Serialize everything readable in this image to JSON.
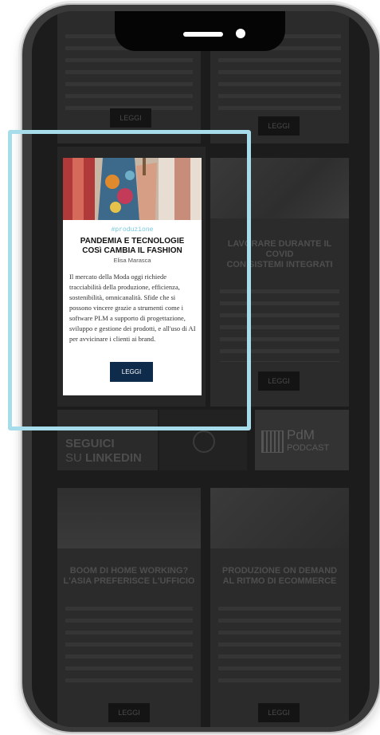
{
  "highlight_card": {
    "tag": "#produzione",
    "title_line1": "PANDEMIA E TECNOLOGIE",
    "title_line2": "COSì CAMBIA IL FASHION",
    "author": "Elisa Marasca",
    "body": "Il mercato della Moda oggi richiede tracciabilità della produzione, efficienza, sostenibilità, omnicanalità. Sfide che si possono vincere grazie a strumenti come i software PLM a supporto di progettazione, sviluppo e gestione dei prodotti, e all'uso di AI per avvicinare i clienti ai brand.",
    "button_label": "LEGGI"
  },
  "background": {
    "top_left_button": "LEGGI",
    "top_right_button": "LEGGI",
    "mid_right": {
      "title_line1": "LAVORARE DURANTE IL",
      "title_line2": "COVID",
      "title_line3": "CON SISTEMI INTEGRATI",
      "button_label": "LEGGI"
    },
    "banner_linkedin": {
      "line1": "SEGUICI",
      "line2": "SU",
      "line3": "LINKEDIN"
    },
    "banner_podcast": {
      "line1": "PdM",
      "line2": "PODCAST"
    },
    "bottom_left": {
      "title_line1": "BOOM DI HOME WORKING?",
      "title_line2": "L'ASIA PREFERISCE L'UFFICIO",
      "button_label": "LEGGI"
    },
    "bottom_right": {
      "title_line1": "PRODUZIONE ON DEMAND",
      "title_line2": "AL RITMO DI ECOMMERCE",
      "button_label": "LEGGI"
    }
  },
  "colors": {
    "frame": "#a7dceb",
    "button": "#0f2b4c",
    "tag": "#73c7dd"
  }
}
